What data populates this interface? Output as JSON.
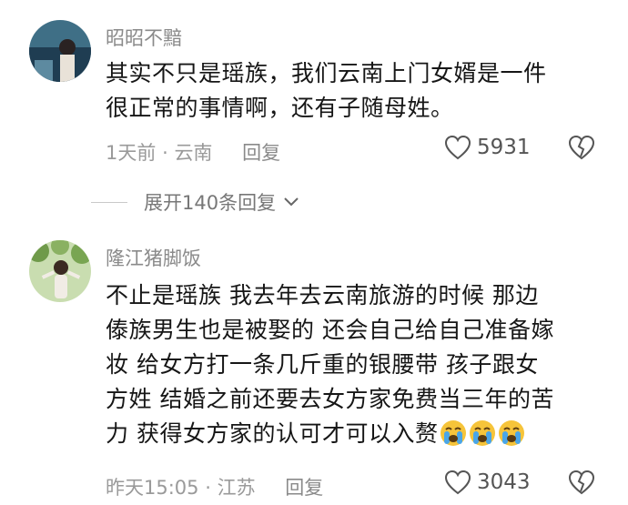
{
  "comments": [
    {
      "username": "昭昭不黯",
      "lines": [
        "其实不只是瑶族，我们云南上门女婿是一件",
        "很正常的事情啊，还有子随母姓。"
      ],
      "time": "1天前",
      "location": "云南",
      "reply_label": "回复",
      "likes": "5931",
      "expand_label": "展开140条回复"
    },
    {
      "username": "隆江猪脚饭",
      "lines": [
        "不止是瑶族 我去年去云南旅游的时候 那边",
        "傣族男生也是被娶的 还会自己给自己准备嫁",
        "妆 给女方打一条几斤重的银腰带 孩子跟女",
        "方姓 结婚之前还要去女方家免费当三年的苦",
        "力 获得女方家的认可才可以入赘"
      ],
      "emoji": [
        "crying-face",
        "crying-face",
        "crying-face"
      ],
      "time": "昨天15:05",
      "location": "江苏",
      "reply_label": "回复",
      "likes": "3043"
    }
  ],
  "meta_separator": "·",
  "colors": {
    "text": "#161616",
    "meta": "#9a9a9a",
    "username": "#8a8a8a",
    "emoji": "#f6c43a"
  }
}
